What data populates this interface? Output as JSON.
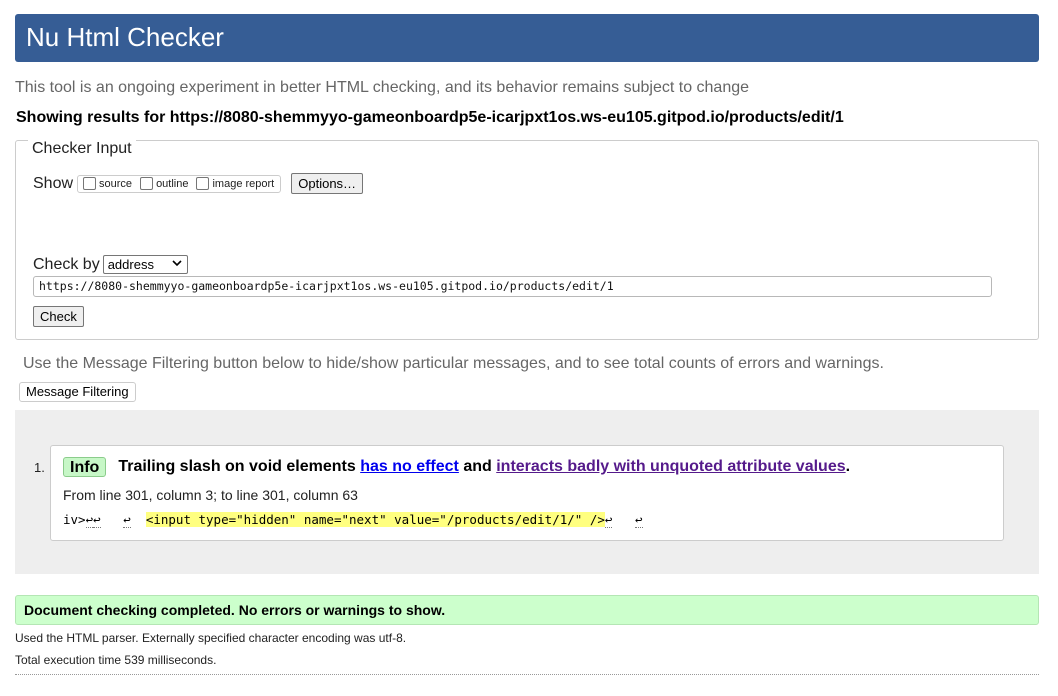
{
  "header": {
    "title": "Nu Html Checker"
  },
  "tagline": "This tool is an ongoing experiment in better HTML checking, and its behavior remains subject to change",
  "showing_results": "Showing results for https://8080-shemmyyo-gameonboardp5e-icarjpxt1os.ws-eu105.gitpod.io/products/edit/1",
  "checker_input": {
    "legend": "Checker Input",
    "show_label": "Show",
    "options": [
      {
        "label": "source",
        "checked": false
      },
      {
        "label": "outline",
        "checked": false
      },
      {
        "label": "image report",
        "checked": false
      }
    ],
    "options_button": "Options…",
    "check_by_label": "Check by",
    "check_by_value": "address",
    "url_value": "https://8080-shemmyyo-gameonboardp5e-icarjpxt1os.ws-eu105.gitpod.io/products/edit/1",
    "check_button": "Check"
  },
  "filter_note": "Use the Message Filtering button below to hide/show particular messages, and to see total counts of errors and warnings.",
  "filter_button": "Message Filtering",
  "messages": [
    {
      "number": "1.",
      "type": "Info",
      "text_before": "Trailing slash on void elements",
      "link1": "has no effect",
      "text_middle": "and",
      "link2": "interacts badly with unquoted attribute values",
      "text_after": ".",
      "location": "From line 301, column 3; to line 301, column 63",
      "extract_prefix": "iv>",
      "extract_highlight": "<input type=\"hidden\" name=\"next\" value=\"/products/edit/1/\" />",
      "linefeed_glyph": "↩"
    }
  ],
  "completed": "Document checking completed. No errors or warnings to show.",
  "footer": {
    "parser_note": "Used the HTML parser. Externally specified character encoding was utf-8.",
    "execution_time": "Total execution time 539 milliseconds."
  },
  "colors": {
    "header_bg": "#365d95",
    "info_badge_bg": "#c7f7c7",
    "success_bg": "#ccffcc",
    "highlight": "#ffff80"
  }
}
